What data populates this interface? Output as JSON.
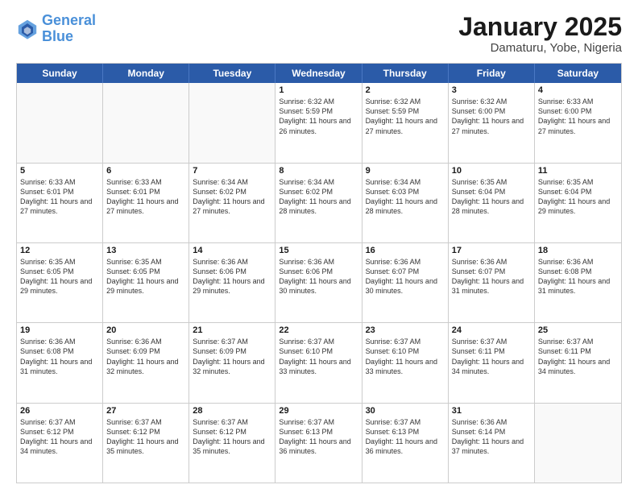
{
  "header": {
    "logo_line1": "General",
    "logo_line2": "Blue",
    "month": "January 2025",
    "location": "Damaturu, Yobe, Nigeria"
  },
  "days_of_week": [
    "Sunday",
    "Monday",
    "Tuesday",
    "Wednesday",
    "Thursday",
    "Friday",
    "Saturday"
  ],
  "weeks": [
    [
      {
        "day": "",
        "info": ""
      },
      {
        "day": "",
        "info": ""
      },
      {
        "day": "",
        "info": ""
      },
      {
        "day": "1",
        "info": "Sunrise: 6:32 AM\nSunset: 5:59 PM\nDaylight: 11 hours and 26 minutes."
      },
      {
        "day": "2",
        "info": "Sunrise: 6:32 AM\nSunset: 5:59 PM\nDaylight: 11 hours and 27 minutes."
      },
      {
        "day": "3",
        "info": "Sunrise: 6:32 AM\nSunset: 6:00 PM\nDaylight: 11 hours and 27 minutes."
      },
      {
        "day": "4",
        "info": "Sunrise: 6:33 AM\nSunset: 6:00 PM\nDaylight: 11 hours and 27 minutes."
      }
    ],
    [
      {
        "day": "5",
        "info": "Sunrise: 6:33 AM\nSunset: 6:01 PM\nDaylight: 11 hours and 27 minutes."
      },
      {
        "day": "6",
        "info": "Sunrise: 6:33 AM\nSunset: 6:01 PM\nDaylight: 11 hours and 27 minutes."
      },
      {
        "day": "7",
        "info": "Sunrise: 6:34 AM\nSunset: 6:02 PM\nDaylight: 11 hours and 27 minutes."
      },
      {
        "day": "8",
        "info": "Sunrise: 6:34 AM\nSunset: 6:02 PM\nDaylight: 11 hours and 28 minutes."
      },
      {
        "day": "9",
        "info": "Sunrise: 6:34 AM\nSunset: 6:03 PM\nDaylight: 11 hours and 28 minutes."
      },
      {
        "day": "10",
        "info": "Sunrise: 6:35 AM\nSunset: 6:04 PM\nDaylight: 11 hours and 28 minutes."
      },
      {
        "day": "11",
        "info": "Sunrise: 6:35 AM\nSunset: 6:04 PM\nDaylight: 11 hours and 29 minutes."
      }
    ],
    [
      {
        "day": "12",
        "info": "Sunrise: 6:35 AM\nSunset: 6:05 PM\nDaylight: 11 hours and 29 minutes."
      },
      {
        "day": "13",
        "info": "Sunrise: 6:35 AM\nSunset: 6:05 PM\nDaylight: 11 hours and 29 minutes."
      },
      {
        "day": "14",
        "info": "Sunrise: 6:36 AM\nSunset: 6:06 PM\nDaylight: 11 hours and 29 minutes."
      },
      {
        "day": "15",
        "info": "Sunrise: 6:36 AM\nSunset: 6:06 PM\nDaylight: 11 hours and 30 minutes."
      },
      {
        "day": "16",
        "info": "Sunrise: 6:36 AM\nSunset: 6:07 PM\nDaylight: 11 hours and 30 minutes."
      },
      {
        "day": "17",
        "info": "Sunrise: 6:36 AM\nSunset: 6:07 PM\nDaylight: 11 hours and 31 minutes."
      },
      {
        "day": "18",
        "info": "Sunrise: 6:36 AM\nSunset: 6:08 PM\nDaylight: 11 hours and 31 minutes."
      }
    ],
    [
      {
        "day": "19",
        "info": "Sunrise: 6:36 AM\nSunset: 6:08 PM\nDaylight: 11 hours and 31 minutes."
      },
      {
        "day": "20",
        "info": "Sunrise: 6:36 AM\nSunset: 6:09 PM\nDaylight: 11 hours and 32 minutes."
      },
      {
        "day": "21",
        "info": "Sunrise: 6:37 AM\nSunset: 6:09 PM\nDaylight: 11 hours and 32 minutes."
      },
      {
        "day": "22",
        "info": "Sunrise: 6:37 AM\nSunset: 6:10 PM\nDaylight: 11 hours and 33 minutes."
      },
      {
        "day": "23",
        "info": "Sunrise: 6:37 AM\nSunset: 6:10 PM\nDaylight: 11 hours and 33 minutes."
      },
      {
        "day": "24",
        "info": "Sunrise: 6:37 AM\nSunset: 6:11 PM\nDaylight: 11 hours and 34 minutes."
      },
      {
        "day": "25",
        "info": "Sunrise: 6:37 AM\nSunset: 6:11 PM\nDaylight: 11 hours and 34 minutes."
      }
    ],
    [
      {
        "day": "26",
        "info": "Sunrise: 6:37 AM\nSunset: 6:12 PM\nDaylight: 11 hours and 34 minutes."
      },
      {
        "day": "27",
        "info": "Sunrise: 6:37 AM\nSunset: 6:12 PM\nDaylight: 11 hours and 35 minutes."
      },
      {
        "day": "28",
        "info": "Sunrise: 6:37 AM\nSunset: 6:12 PM\nDaylight: 11 hours and 35 minutes."
      },
      {
        "day": "29",
        "info": "Sunrise: 6:37 AM\nSunset: 6:13 PM\nDaylight: 11 hours and 36 minutes."
      },
      {
        "day": "30",
        "info": "Sunrise: 6:37 AM\nSunset: 6:13 PM\nDaylight: 11 hours and 36 minutes."
      },
      {
        "day": "31",
        "info": "Sunrise: 6:36 AM\nSunset: 6:14 PM\nDaylight: 11 hours and 37 minutes."
      },
      {
        "day": "",
        "info": ""
      }
    ]
  ]
}
